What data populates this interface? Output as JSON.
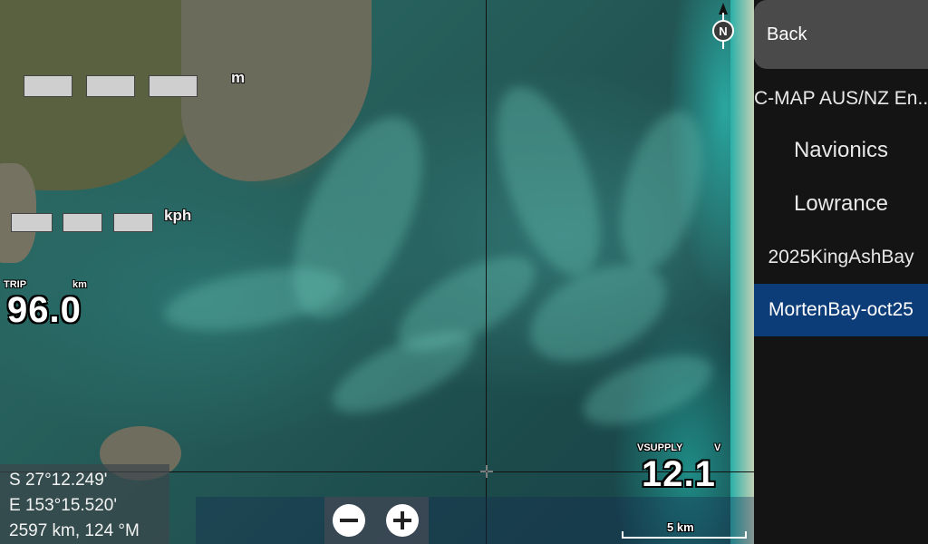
{
  "map": {
    "depth_unit": "m",
    "speed_unit": "kph",
    "trip": {
      "label": "TRIP",
      "unit": "km",
      "value": "96.0"
    },
    "vsupply": {
      "label": "VSUPPLY",
      "unit": "V",
      "value": "12.1"
    },
    "coords": {
      "lat": "S  27°12.249'",
      "lon": "E 153°15.520'",
      "range_bearing": "2597 km, 124 °M"
    },
    "scale_label": "5 km",
    "compass_letter": "N"
  },
  "menu": {
    "back_label": "Back",
    "items": [
      {
        "label": "C-MAP AUS/NZ En..."
      },
      {
        "label": "Navionics"
      },
      {
        "label": "Lowrance"
      },
      {
        "label": "2025KingAshBay"
      },
      {
        "label": "MortenBay-oct25"
      }
    ],
    "selected_index": 4,
    "selected_color": "#0d3d78"
  },
  "icons": [
    "north-compass-icon",
    "zoom-out-icon",
    "zoom-in-icon",
    "crosshair-icon"
  ]
}
